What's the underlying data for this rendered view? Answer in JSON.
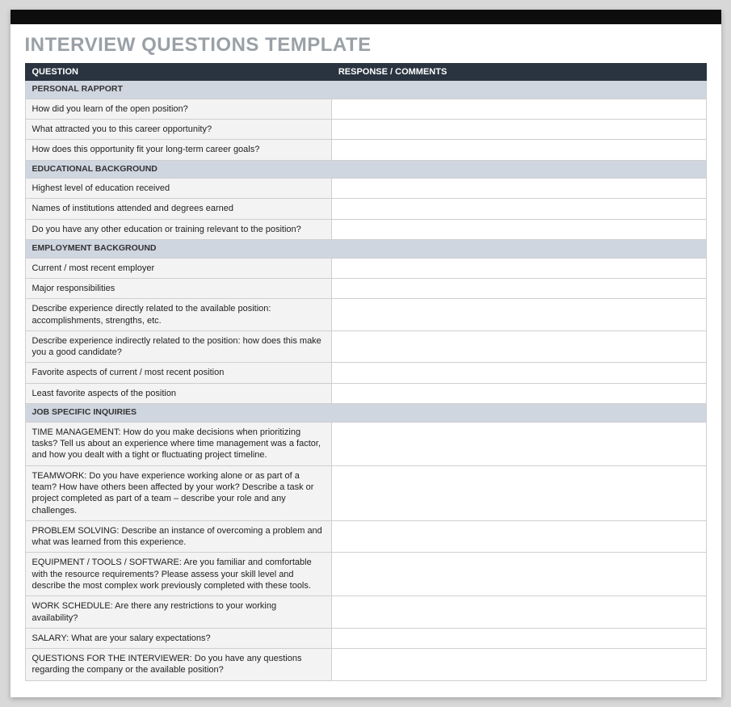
{
  "title": "INTERVIEW QUESTIONS TEMPLATE",
  "headers": {
    "question": "QUESTION",
    "response": "RESPONSE / COMMENTS"
  },
  "sections": [
    {
      "name": "PERSONAL RAPPORT",
      "questions": [
        "How did you learn of the open position?",
        "What attracted you to this career opportunity?",
        "How does this opportunity fit your long-term career goals?"
      ]
    },
    {
      "name": "EDUCATIONAL BACKGROUND",
      "questions": [
        "Highest level of education received",
        "Names of institutions attended and degrees earned",
        "Do you have any other education or training relevant to the position?"
      ]
    },
    {
      "name": "EMPLOYMENT BACKGROUND",
      "questions": [
        "Current / most recent employer",
        "Major responsibilities",
        "Describe experience directly related to the available position: accomplishments, strengths, etc.",
        "Describe experience indirectly related to the position: how does this make you a good candidate?",
        "Favorite aspects of current / most recent position",
        "Least favorite aspects of the position"
      ]
    },
    {
      "name": "JOB SPECIFIC INQUIRIES",
      "questions": [
        "TIME MANAGEMENT: How do you make decisions when prioritizing tasks? Tell us about an experience where time management was a factor, and how you dealt with a tight or fluctuating project timeline.",
        "TEAMWORK: Do you have experience working alone or as part of a team? How have others been affected by your work? Describe a task or project completed as part of a team – describe your role and any challenges.",
        "PROBLEM SOLVING: Describe an instance of overcoming a problem and what was learned from this experience.",
        "EQUIPMENT / TOOLS / SOFTWARE: Are you familiar and comfortable with the resource requirements? Please assess your skill level and describe the most complex work previously completed with these tools.",
        "WORK SCHEDULE: Are there any restrictions to your working availability?",
        "SALARY: What are your salary expectations?",
        "QUESTIONS FOR THE INTERVIEWER: Do you have any questions regarding the company or the available position?"
      ]
    }
  ]
}
